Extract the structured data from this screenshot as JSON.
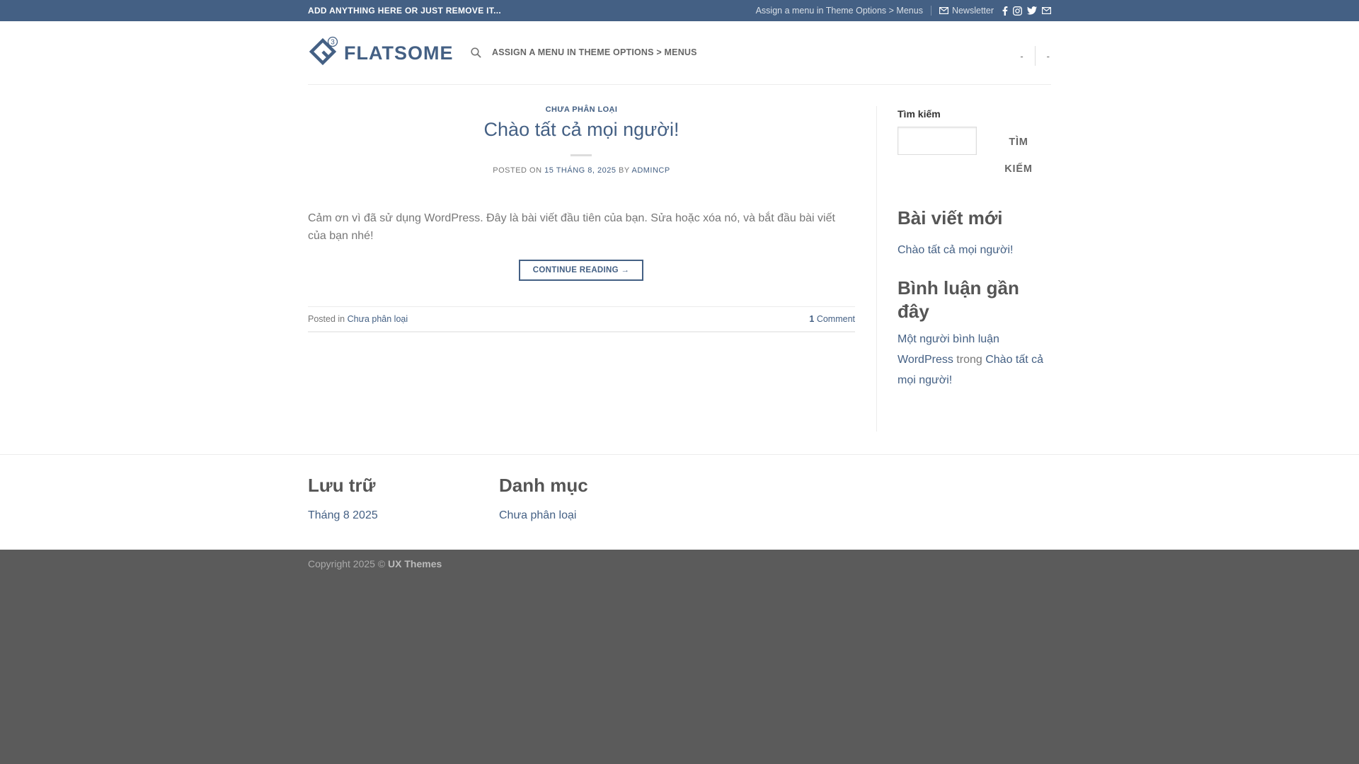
{
  "colors": {
    "primary": "#446084",
    "footer_bg": "#5b5b5b"
  },
  "topbar": {
    "left_text": "ADD ANYTHING HERE OR JUST REMOVE IT...",
    "menu_text": "Assign a menu in Theme Options > Menus",
    "newsletter_label": "Newsletter",
    "social_icons": [
      "facebook-icon",
      "instagram-icon",
      "twitter-icon",
      "envelope-icon"
    ]
  },
  "header": {
    "logo_text": "FLATSOME",
    "logo_badge": "3",
    "nav_label": "ASSIGN A MENU IN THEME OPTIONS > MENUS",
    "right_items": [
      "-",
      "-"
    ]
  },
  "post": {
    "category": "CHƯA PHÂN LOẠI",
    "title": "Chào tất cả mọi người!",
    "meta_posted_on": "POSTED ON",
    "meta_date": "15 THÁNG 8, 2025",
    "meta_by": "BY",
    "meta_author": "ADMINCP",
    "excerpt": "Cảm ơn vì đã sử dụng WordPress. Đây là bài viết đầu tiên của bạn. Sửa hoặc xóa nó, và bắt đầu bài viết của bạn nhé!",
    "continue_label": "CONTINUE READING →",
    "footer_posted_in": "Posted in",
    "footer_category": "Chưa phân loại",
    "comment_count": "1",
    "comment_label": "Comment"
  },
  "sidebar": {
    "search_title": "Tìm kiếm",
    "search_button_line1": "TÌM",
    "search_button_line2": "KIẾM",
    "recent_posts_heading": "Bài viết mới",
    "recent_post_1": "Chào tất cả mọi người!",
    "recent_comments_heading_line1": "Bình luận gần",
    "recent_comments_heading_line2": "đây",
    "comment_author": "Một người bình luận WordPress",
    "comment_in": "trong",
    "comment_post": "Chào tất cả mọi người!"
  },
  "footer_widgets": {
    "archives_heading": "Lưu trữ",
    "archive_1": "Tháng 8 2025",
    "categories_heading": "Danh mục",
    "category_1": "Chưa phân loại"
  },
  "bottom": {
    "copyright_prefix": "Copyright 2025 ©",
    "copyright_owner": "UX Themes"
  }
}
